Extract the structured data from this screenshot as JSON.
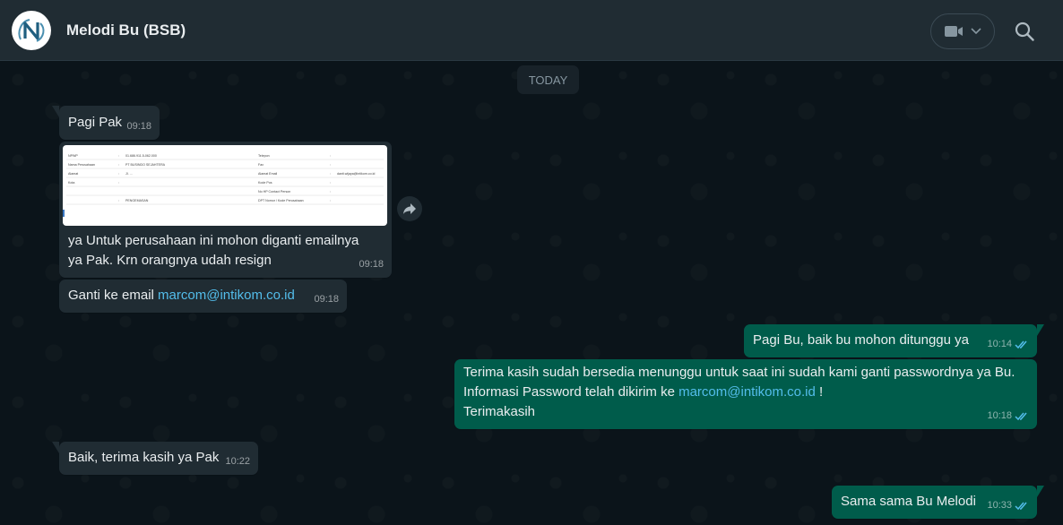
{
  "header": {
    "title": "Melodi Bu (BSB)",
    "avatar_letter": "N",
    "video_icon": "video-camera-icon",
    "video_dropdown_icon": "chevron-down-icon",
    "search_icon": "search-icon"
  },
  "colors": {
    "header_bg": "#202c33",
    "chat_bg": "#0b141a",
    "incoming_bubble": "#202c33",
    "outgoing_bubble": "#005c4b",
    "link": "#53bdeb",
    "read_ticks": "#53bdeb",
    "avatar_accent": "#2a6f8f"
  },
  "chat": {
    "date_label": "TODAY",
    "messages": [
      {
        "dir": "in",
        "text": "Pagi Pak",
        "time": "09:18"
      },
      {
        "dir": "in",
        "type": "image",
        "caption": "ya Untuk perusahaan ini mohon diganti emailnya\nya Pak. Krn orangnya udah resign",
        "time": "09:18",
        "image_rows": [
          [
            "NPWP",
            ":",
            "01.686.911.5-062.000",
            "Telepon",
            ":",
            ""
          ],
          [
            "Nama Perusahaan",
            ":",
            "PT BUSINDO SEJAHTERA",
            "Fax",
            ":",
            ""
          ],
          [
            "Alamat",
            ":",
            "Jl. ...",
            "Alamat Email",
            ":",
            "danti.wijaya@intikom.co.id"
          ],
          [
            "Kota",
            ":",
            "",
            "Kode Pos",
            ":",
            ""
          ],
          [
            "",
            "",
            "",
            "No HP Contact Person",
            ":",
            ""
          ],
          [
            "",
            ":",
            "PENGEMASAN",
            "DPT Nomor / Kode Perusahaan",
            ":",
            ""
          ]
        ]
      },
      {
        "dir": "in",
        "text_prefix": "Ganti ke email",
        "link": "marcom@intikom.co.id",
        "time": "09:18"
      },
      {
        "dir": "out",
        "text": "Pagi Bu, baik bu mohon ditunggu ya",
        "time": "10:14"
      },
      {
        "dir": "out",
        "line1": "Terima kasih sudah bersedia menunggu untuk saat ini sudah kami ganti passwordnya ya Bu.",
        "line2_prefix": "Informasi Password telah dikirim ke",
        "line2_link": "marcom@intikom.co.id",
        "line2_suffix": "!",
        "line3": "Terimakasih",
        "time": "10:18"
      },
      {
        "dir": "in",
        "text": "Baik, terima kasih ya Pak",
        "time": "10:22"
      },
      {
        "dir": "out",
        "text": "Sama sama Bu Melodi",
        "time": "10:33"
      }
    ],
    "forward_icon": "forward-arrow-icon",
    "read_receipt_icon": "double-check-icon"
  }
}
